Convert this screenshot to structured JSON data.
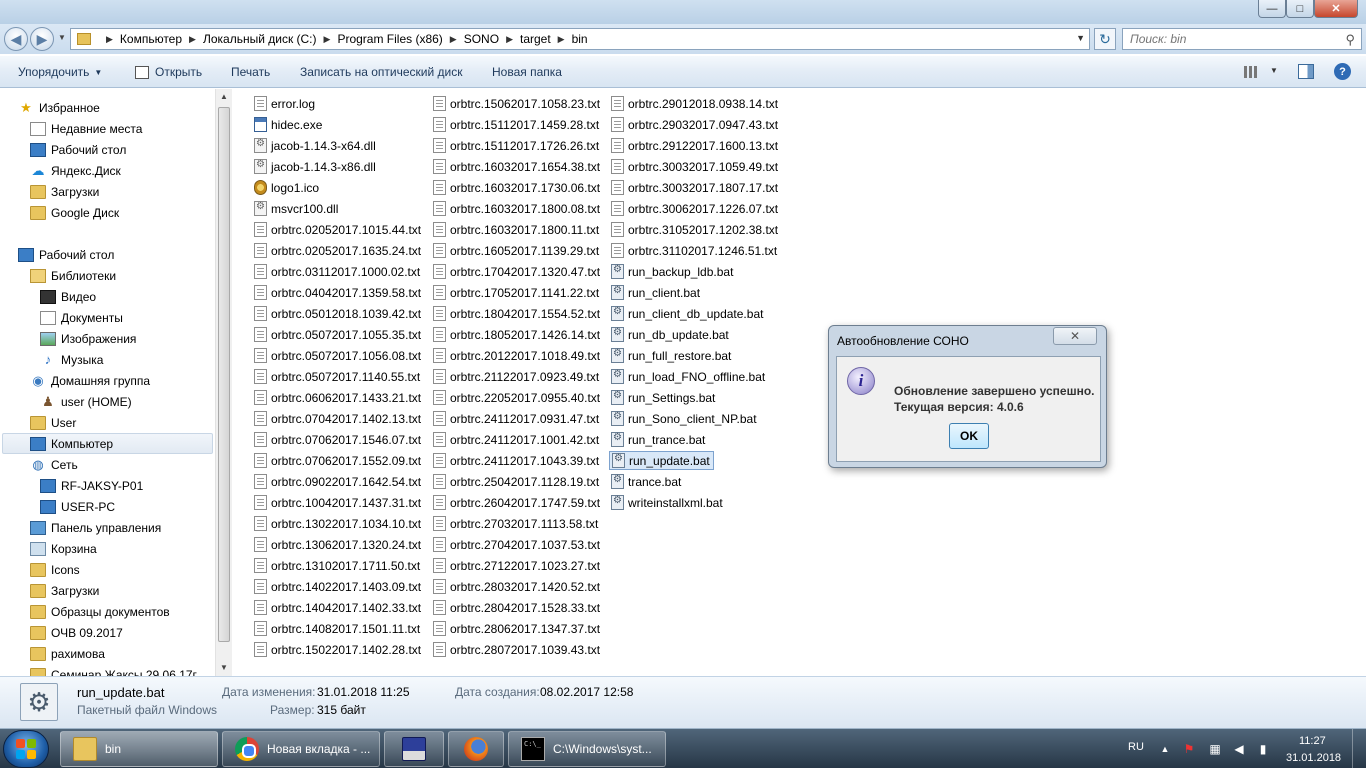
{
  "window": {
    "controls": {
      "minimize": "—",
      "maximize": "□",
      "close": "✕"
    }
  },
  "address": {
    "crumbs": [
      "Компьютер",
      "Локальный диск (C:)",
      "Program Files (x86)",
      "SONO",
      "target",
      "bin"
    ],
    "search_placeholder": "Поиск: bin"
  },
  "toolbar": {
    "organize": "Упорядочить",
    "open": "Открыть",
    "print": "Печать",
    "burn": "Записать на оптический диск",
    "new_folder": "Новая папка"
  },
  "nav": {
    "favorites": "Избранное",
    "recent": "Недавние места",
    "desktop_fav": "Рабочий стол",
    "yandex_disk": "Яндекс.Диск",
    "downloads_fav": "Загрузки",
    "google_drive": "Google Диск",
    "desktop": "Рабочий стол",
    "libraries": "Библиотеки",
    "video": "Видео",
    "documents": "Документы",
    "images": "Изображения",
    "music": "Музыка",
    "homegroup": "Домашняя группа",
    "user_home": "user (HOME)",
    "user": "User",
    "computer": "Компьютер",
    "network": "Сеть",
    "pc1": "RF-JAKSY-P01",
    "pc2": "USER-PC",
    "control_panel": "Панель управления",
    "recycle_bin": "Корзина",
    "icons": "Icons",
    "downloads": "Загрузки",
    "samples": "Образцы документов",
    "ochv": "ОЧВ 09.2017",
    "rakhimova": "рахимова",
    "seminar": "Семинар Жаксы 29.06.17г"
  },
  "files": {
    "col1": [
      {
        "name": "error.log",
        "type": "txt"
      },
      {
        "name": "hidec.exe",
        "type": "exe"
      },
      {
        "name": "jacob-1.14.3-x64.dll",
        "type": "dll"
      },
      {
        "name": "jacob-1.14.3-x86.dll",
        "type": "dll"
      },
      {
        "name": "logo1.ico",
        "type": "ico"
      },
      {
        "name": "msvcr100.dll",
        "type": "dll"
      },
      {
        "name": "orbtrc.02052017.1015.44.txt",
        "type": "txt"
      },
      {
        "name": "orbtrc.02052017.1635.24.txt",
        "type": "txt"
      },
      {
        "name": "orbtrc.03112017.1000.02.txt",
        "type": "txt"
      },
      {
        "name": "orbtrc.04042017.1359.58.txt",
        "type": "txt"
      },
      {
        "name": "orbtrc.05012018.1039.42.txt",
        "type": "txt"
      },
      {
        "name": "orbtrc.05072017.1055.35.txt",
        "type": "txt"
      },
      {
        "name": "orbtrc.05072017.1056.08.txt",
        "type": "txt"
      },
      {
        "name": "orbtrc.05072017.1140.55.txt",
        "type": "txt"
      },
      {
        "name": "orbtrc.06062017.1433.21.txt",
        "type": "txt"
      },
      {
        "name": "orbtrc.07042017.1402.13.txt",
        "type": "txt"
      },
      {
        "name": "orbtrc.07062017.1546.07.txt",
        "type": "txt"
      },
      {
        "name": "orbtrc.07062017.1552.09.txt",
        "type": "txt"
      },
      {
        "name": "orbtrc.09022017.1642.54.txt",
        "type": "txt"
      },
      {
        "name": "orbtrc.10042017.1437.31.txt",
        "type": "txt"
      },
      {
        "name": "orbtrc.13022017.1034.10.txt",
        "type": "txt"
      },
      {
        "name": "orbtrc.13062017.1320.24.txt",
        "type": "txt"
      },
      {
        "name": "orbtrc.13102017.1711.50.txt",
        "type": "txt"
      },
      {
        "name": "orbtrc.14022017.1403.09.txt",
        "type": "txt"
      },
      {
        "name": "orbtrc.14042017.1402.33.txt",
        "type": "txt"
      },
      {
        "name": "orbtrc.14082017.1501.11.txt",
        "type": "txt"
      },
      {
        "name": "orbtrc.15022017.1402.28.txt",
        "type": "txt"
      }
    ],
    "col2": [
      {
        "name": "orbtrc.15062017.1058.23.txt",
        "type": "txt"
      },
      {
        "name": "orbtrc.15112017.1459.28.txt",
        "type": "txt"
      },
      {
        "name": "orbtrc.15112017.1726.26.txt",
        "type": "txt"
      },
      {
        "name": "orbtrc.16032017.1654.38.txt",
        "type": "txt"
      },
      {
        "name": "orbtrc.16032017.1730.06.txt",
        "type": "txt"
      },
      {
        "name": "orbtrc.16032017.1800.08.txt",
        "type": "txt"
      },
      {
        "name": "orbtrc.16032017.1800.11.txt",
        "type": "txt"
      },
      {
        "name": "orbtrc.16052017.1139.29.txt",
        "type": "txt"
      },
      {
        "name": "orbtrc.17042017.1320.47.txt",
        "type": "txt"
      },
      {
        "name": "orbtrc.17052017.1141.22.txt",
        "type": "txt"
      },
      {
        "name": "orbtrc.18042017.1554.52.txt",
        "type": "txt"
      },
      {
        "name": "orbtrc.18052017.1426.14.txt",
        "type": "txt"
      },
      {
        "name": "orbtrc.20122017.1018.49.txt",
        "type": "txt"
      },
      {
        "name": "orbtrc.21122017.0923.49.txt",
        "type": "txt"
      },
      {
        "name": "orbtrc.22052017.0955.40.txt",
        "type": "txt"
      },
      {
        "name": "orbtrc.24112017.0931.47.txt",
        "type": "txt"
      },
      {
        "name": "orbtrc.24112017.1001.42.txt",
        "type": "txt"
      },
      {
        "name": "orbtrc.24112017.1043.39.txt",
        "type": "txt"
      },
      {
        "name": "orbtrc.25042017.1128.19.txt",
        "type": "txt"
      },
      {
        "name": "orbtrc.26042017.1747.59.txt",
        "type": "txt"
      },
      {
        "name": "orbtrc.27032017.1113.58.txt",
        "type": "txt"
      },
      {
        "name": "orbtrc.27042017.1037.53.txt",
        "type": "txt"
      },
      {
        "name": "orbtrc.27122017.1023.27.txt",
        "type": "txt"
      },
      {
        "name": "orbtrc.28032017.1420.52.txt",
        "type": "txt"
      },
      {
        "name": "orbtrc.28042017.1528.33.txt",
        "type": "txt"
      },
      {
        "name": "orbtrc.28062017.1347.37.txt",
        "type": "txt"
      },
      {
        "name": "orbtrc.28072017.1039.43.txt",
        "type": "txt"
      }
    ],
    "col3": [
      {
        "name": "orbtrc.29012018.0938.14.txt",
        "type": "txt"
      },
      {
        "name": "orbtrc.29032017.0947.43.txt",
        "type": "txt"
      },
      {
        "name": "orbtrc.29122017.1600.13.txt",
        "type": "txt"
      },
      {
        "name": "orbtrc.30032017.1059.49.txt",
        "type": "txt"
      },
      {
        "name": "orbtrc.30032017.1807.17.txt",
        "type": "txt"
      },
      {
        "name": "orbtrc.30062017.1226.07.txt",
        "type": "txt"
      },
      {
        "name": "orbtrc.31052017.1202.38.txt",
        "type": "txt"
      },
      {
        "name": "orbtrc.31102017.1246.51.txt",
        "type": "txt"
      },
      {
        "name": "run_backup_ldb.bat",
        "type": "bat"
      },
      {
        "name": "run_client.bat",
        "type": "bat"
      },
      {
        "name": "run_client_db_update.bat",
        "type": "bat"
      },
      {
        "name": "run_db_update.bat",
        "type": "bat"
      },
      {
        "name": "run_full_restore.bat",
        "type": "bat"
      },
      {
        "name": "run_load_FNO_offline.bat",
        "type": "bat"
      },
      {
        "name": "run_Settings.bat",
        "type": "bat"
      },
      {
        "name": "run_Sono_client_NP.bat",
        "type": "bat"
      },
      {
        "name": "run_trance.bat",
        "type": "bat"
      },
      {
        "name": "run_update.bat",
        "type": "bat",
        "selected": true
      },
      {
        "name": "trance.bat",
        "type": "bat"
      },
      {
        "name": "writeinstallxml.bat",
        "type": "bat"
      }
    ]
  },
  "dialog": {
    "title": "Автообновление СОНО",
    "close": "✕",
    "line1": "Обновление завершено успешно.",
    "line2": "Текущая версия: 4.0.6",
    "ok": "OK"
  },
  "details": {
    "name": "run_update.bat",
    "type": "Пакетный файл Windows",
    "modified_label": "Дата изменения:",
    "modified_value": "31.01.2018 11:25",
    "created_label": "Дата создания:",
    "created_value": "08.02.2017 12:58",
    "size_label": "Размер:",
    "size_value": "315 байт"
  },
  "taskbar": {
    "explorer": "bin",
    "chrome": "Новая вкладка - ...",
    "cmd": "C:\\Windows\\syst...",
    "cmd_icon_text": "C:\\_",
    "lang": "RU",
    "time": "11:27",
    "date": "31.01.2018"
  },
  "colors": {
    "selection": "#d9e8f8",
    "selection_border": "#7da2ce",
    "toolbar_text": "#1e395b"
  }
}
